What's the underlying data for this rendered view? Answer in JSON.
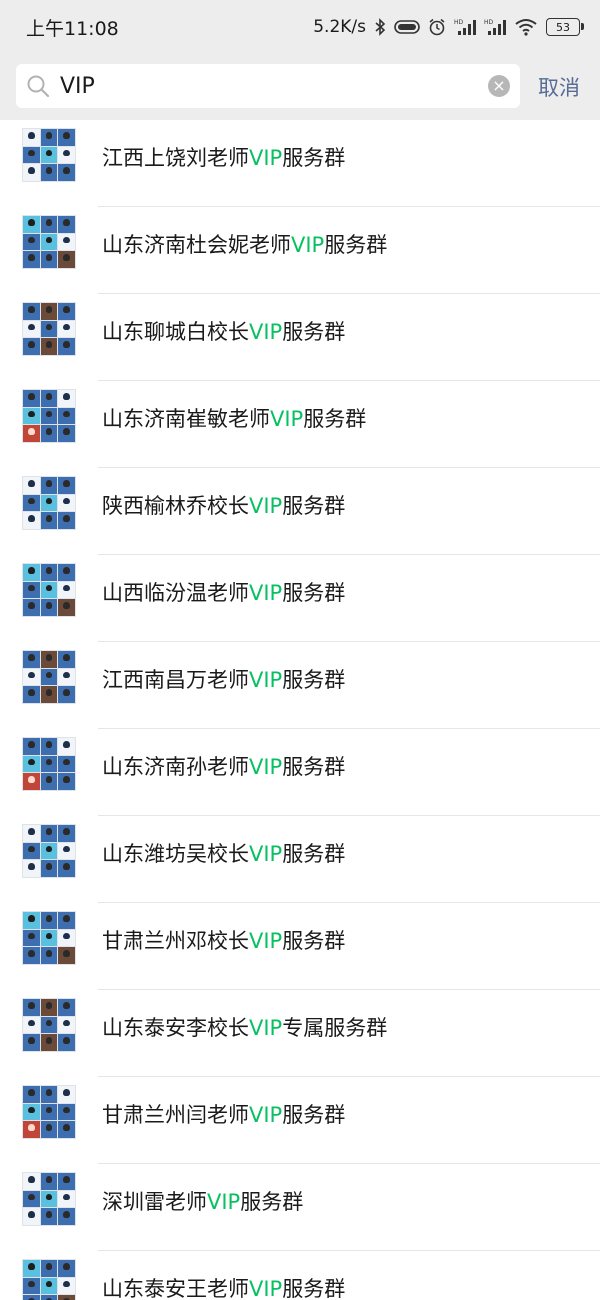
{
  "status_bar": {
    "time": "上午11:08",
    "speed": "5.2K/s",
    "battery": "53",
    "icons": [
      "bluetooth-icon",
      "toggle-icon",
      "alarm-icon",
      "signal-hd-icon",
      "signal-hd-icon",
      "wifi-icon",
      "battery-icon"
    ]
  },
  "search": {
    "query": "VIP",
    "cancel_label": "取消"
  },
  "colors": {
    "highlight": "#07c160",
    "cancel": "#576b95",
    "header_bg": "#ededed"
  },
  "results": [
    {
      "prefix": "江西上饶刘老师",
      "match": "VIP",
      "suffix": "服务群"
    },
    {
      "prefix": "山东济南杜会妮老师",
      "match": "VIP",
      "suffix": "服务群"
    },
    {
      "prefix": "山东聊城白校长",
      "match": "VIP",
      "suffix": "服务群"
    },
    {
      "prefix": "山东济南崔敏老师",
      "match": "VIP",
      "suffix": "服务群"
    },
    {
      "prefix": "陕西榆林乔校长",
      "match": "VIP",
      "suffix": "服务群"
    },
    {
      "prefix": "山西临汾温老师",
      "match": "VIP",
      "suffix": "服务群"
    },
    {
      "prefix": "江西南昌万老师",
      "match": "VIP",
      "suffix": "服务群"
    },
    {
      "prefix": "山东济南孙老师",
      "match": "VIP",
      "suffix": "服务群"
    },
    {
      "prefix": "山东潍坊吴校长",
      "match": "VIP",
      "suffix": "服务群"
    },
    {
      "prefix": "甘肃兰州邓校长",
      "match": "VIP",
      "suffix": "服务群"
    },
    {
      "prefix": "山东泰安李校长",
      "match": "VIP",
      "suffix": "专属服务群"
    },
    {
      "prefix": "甘肃兰州闫老师",
      "match": "VIP",
      "suffix": "服务群"
    },
    {
      "prefix": "深圳雷老师",
      "match": "VIP",
      "suffix": "服务群"
    },
    {
      "prefix": "山东泰安王老师",
      "match": "VIP",
      "suffix": "服务群"
    }
  ]
}
